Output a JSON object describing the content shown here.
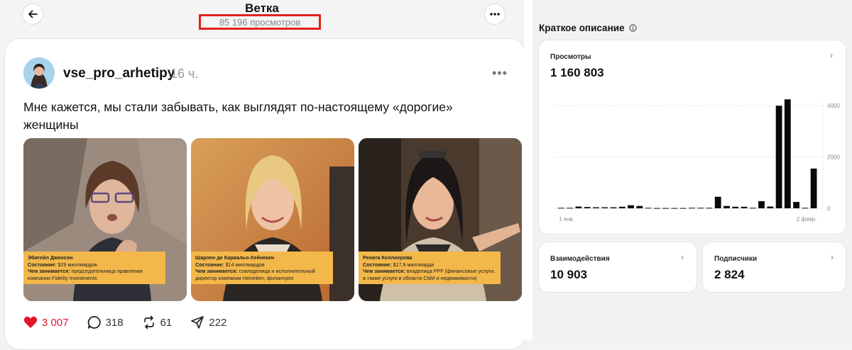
{
  "thread": {
    "title": "Ветка",
    "views": "85 196 просмотров"
  },
  "post": {
    "username": "vse_pro_arhetipy",
    "time": "16 ч.",
    "text": "Мне кажется, мы стали забывать, как выглядят по-настоящему «дорогие» женщины",
    "images": [
      {
        "name": "Эбигейл Джонсон",
        "state_label": "Состояние:",
        "state": "$29 миллиардов",
        "job_label": "Чем занимается:",
        "job": "председательница правления компании Fidelity Investments"
      },
      {
        "name": "Шарлен де Карвальо-Хейнекен",
        "state_label": "Состояние:",
        "state": "$14 миллиардов",
        "job_label": "Чем занимается:",
        "job": "совладелица и исполнительный директор компании Heineken, филантроп"
      },
      {
        "name": "Рената Келлнерова",
        "state_label": "Состояние:",
        "state": "$17,9 миллиарда",
        "job_label": "Чем занимается:",
        "job": "владелица PPF (финансовые услуги, а также услуги в области СМИ и недвижимости)"
      }
    ],
    "actions": {
      "likes": "3 007",
      "replies": "318",
      "reposts": "61",
      "shares": "222"
    }
  },
  "summary": {
    "title": "Краткое описание",
    "info_icon": "info-icon",
    "views_label": "Просмотры",
    "views_total": "1 160 803",
    "interactions_label": "Взаимодействия",
    "interactions": "10 903",
    "followers_label": "Подписчики",
    "followers": "2 824"
  },
  "colors": {
    "like": "#e0162b",
    "highlight_border": "#e2231a",
    "caption_bg": "#f3b84a"
  },
  "chart_data": {
    "type": "bar",
    "x_tick_labels": [
      "1 янв.",
      "2 февр."
    ],
    "y_tick_labels": [
      "0",
      "2000",
      "4000"
    ],
    "ylim": [
      0,
      4200
    ],
    "grid": true,
    "values": [
      20,
      20,
      70,
      50,
      40,
      40,
      40,
      60,
      120,
      90,
      20,
      10,
      10,
      10,
      10,
      20,
      20,
      20,
      450,
      90,
      60,
      60,
      20,
      280,
      70,
      4000,
      4250,
      250,
      20,
      1550
    ]
  }
}
